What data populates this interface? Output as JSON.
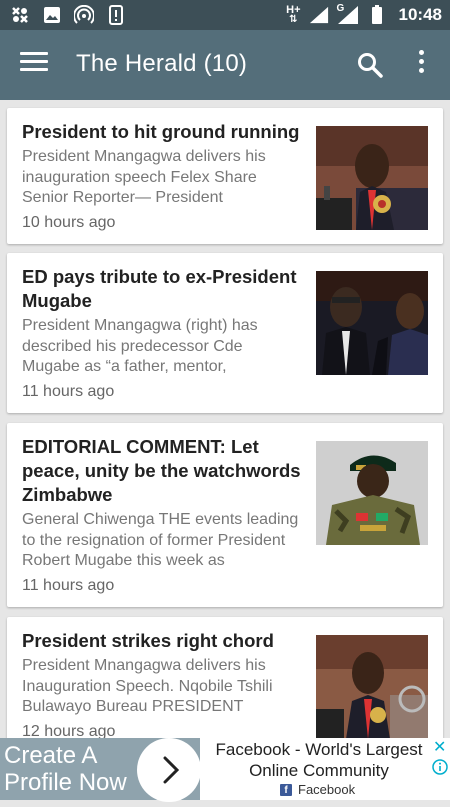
{
  "status_bar": {
    "time": "10:48",
    "network_label": "H+",
    "signal2_label": "G",
    "icons": [
      "gallery-app-icon",
      "image-icon",
      "hotspot-icon",
      "phone-icon",
      "wifi-signal-icon",
      "signal-icon",
      "battery-icon"
    ]
  },
  "toolbar": {
    "title": "The Herald (10)",
    "menu_icon": "hamburger-menu-icon",
    "search_icon": "search-icon",
    "more_icon": "more-vertical-icon",
    "bg_color": "#546e7a"
  },
  "articles": [
    {
      "headline": "President to hit ground running",
      "summary": "President Mnangagwa delivers his inauguration speech Felex Share Senior Reporter— President",
      "time": "10 hours ago",
      "image": "president-speech-photo"
    },
    {
      "headline": "ED pays tribute to  ex-President Mugabe",
      "summary": "President Mnangagwa (right) has described his predecessor Cde Mugabe as “a father, mentor,",
      "time": "11 hours ago",
      "image": "mugabe-photo"
    },
    {
      "headline": "EDITORIAL COMMENT: Let peace, unity be the watchwords Zimbabwe",
      "summary": "General Chiwenga THE events leading to the resignation of former President Robert Mugabe this week as",
      "time": "11 hours ago",
      "image": "general-chiwenga-photo"
    },
    {
      "headline": "President strikes right chord",
      "summary": "President Mnangagwa delivers his Inauguration Speech. Nqobile Tshili Bulawayo Bureau PRESIDENT",
      "time": "12 hours ago",
      "image": "president-inauguration-photo"
    }
  ],
  "ad": {
    "left_text": "Create A Profile Now",
    "title": "Facebook - World's Largest Online Community",
    "brand": "Facebook",
    "close_icon": "close-icon",
    "info_icon": "info-icon"
  }
}
